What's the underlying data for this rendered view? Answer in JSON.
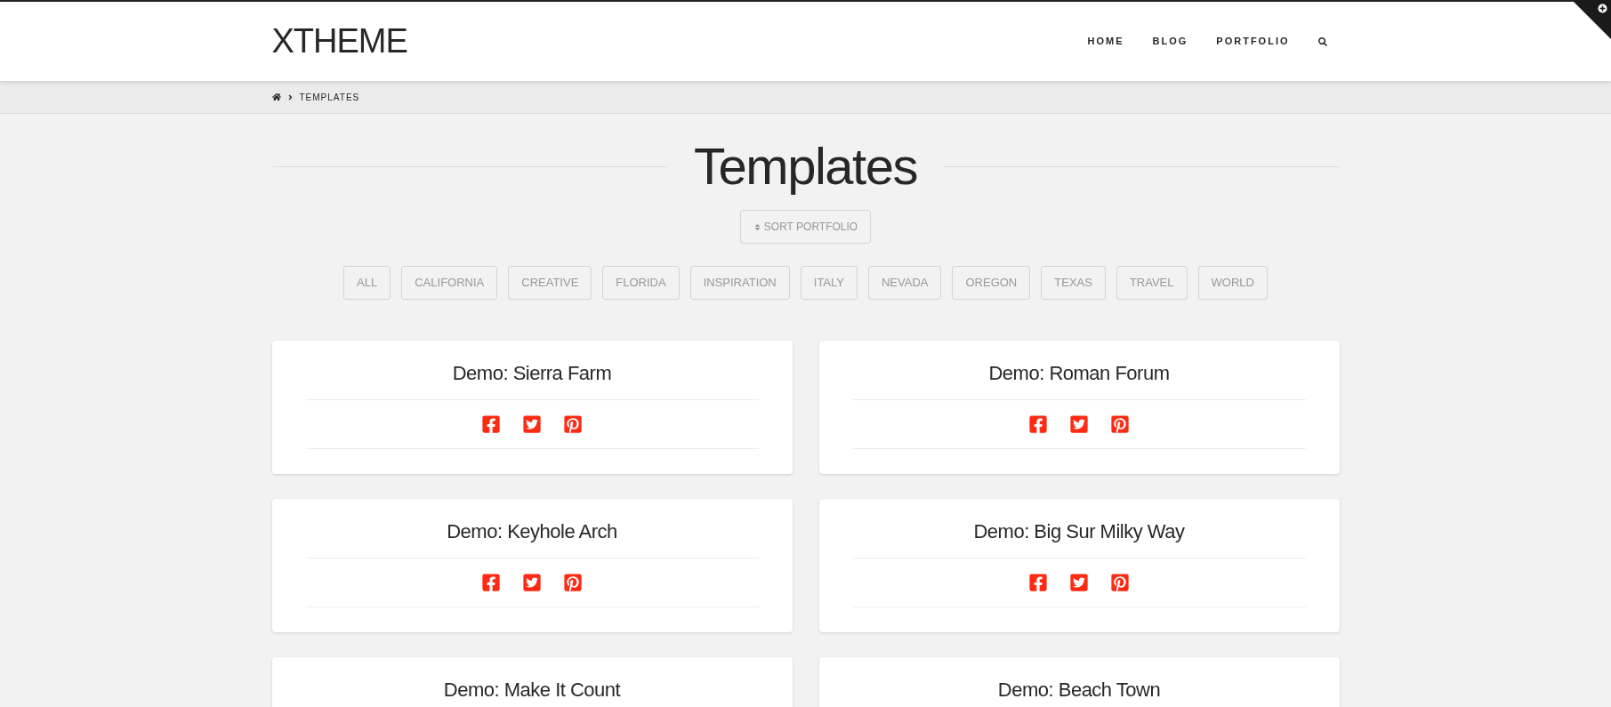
{
  "header": {
    "logo": "XTHEME",
    "nav": [
      "HOME",
      "BLOG",
      "PORTFOLIO"
    ]
  },
  "breadcrumb": {
    "current": "TEMPLATES"
  },
  "page_title": "Templates",
  "sort_button": "SORT PORTFOLIO",
  "filters": [
    "ALL",
    "CALIFORNIA",
    "CREATIVE",
    "FLORIDA",
    "INSPIRATION",
    "ITALY",
    "NEVADA",
    "OREGON",
    "TEXAS",
    "TRAVEL",
    "WORLD"
  ],
  "cards": [
    {
      "title": "Demo: Sierra Farm"
    },
    {
      "title": "Demo: Roman Forum"
    },
    {
      "title": "Demo: Keyhole Arch"
    },
    {
      "title": "Demo: Big Sur Milky Way"
    }
  ],
  "cards_cut_off": [
    {
      "title": "Demo: Make It Count"
    },
    {
      "title": "Demo: Beach Town"
    }
  ]
}
